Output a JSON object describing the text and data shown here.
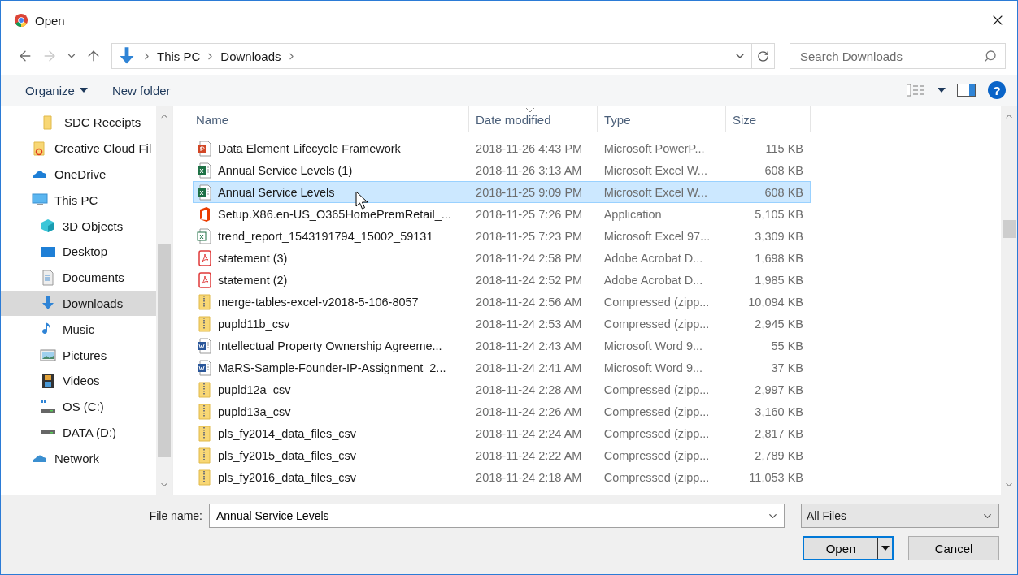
{
  "window": {
    "title": "Open"
  },
  "address": {
    "crumbs": [
      "This PC",
      "Downloads"
    ]
  },
  "search": {
    "placeholder": "Search Downloads"
  },
  "toolbar": {
    "organize": "Organize",
    "new_folder": "New folder",
    "help": "?"
  },
  "sidebar": {
    "items": [
      {
        "label": "SDC Receipts",
        "kind": "folder",
        "selected": false
      },
      {
        "label": "Creative Cloud Fil",
        "kind": "cloudfolder",
        "selected": false
      },
      {
        "label": "OneDrive",
        "kind": "onedrive",
        "selected": false
      },
      {
        "label": "This PC",
        "kind": "pc",
        "selected": false,
        "children": [
          {
            "label": "3D Objects",
            "kind": "cube",
            "selected": false
          },
          {
            "label": "Desktop",
            "kind": "desktop",
            "selected": false
          },
          {
            "label": "Documents",
            "kind": "documents",
            "selected": false
          },
          {
            "label": "Downloads",
            "kind": "downloads",
            "selected": true
          },
          {
            "label": "Music",
            "kind": "music",
            "selected": false
          },
          {
            "label": "Pictures",
            "kind": "pictures",
            "selected": false
          },
          {
            "label": "Videos",
            "kind": "videos",
            "selected": false
          },
          {
            "label": "OS (C:)",
            "kind": "osdrive",
            "selected": false
          },
          {
            "label": "DATA (D:)",
            "kind": "drive",
            "selected": false
          }
        ]
      },
      {
        "label": "Network",
        "kind": "network",
        "selected": false
      }
    ]
  },
  "table": {
    "columns": [
      "Name",
      "Date modified",
      "Type",
      "Size"
    ],
    "rows": [
      {
        "name": "Data Element Lifecycle Framework",
        "date": "2018-11-26 4:43 PM",
        "type": "Microsoft PowerP...",
        "size": "115 KB",
        "kind": "ppt",
        "selected": false
      },
      {
        "name": "Annual Service Levels (1)",
        "date": "2018-11-26 3:13 AM",
        "type": "Microsoft Excel W...",
        "size": "608 KB",
        "kind": "excel",
        "selected": false
      },
      {
        "name": "Annual Service Levels",
        "date": "2018-11-25 9:09 PM",
        "type": "Microsoft Excel W...",
        "size": "608 KB",
        "kind": "excel",
        "selected": true
      },
      {
        "name": "Setup.X86.en-US_O365HomePremRetail_...",
        "date": "2018-11-25 7:26 PM",
        "type": "Application",
        "size": "5,105 KB",
        "kind": "app",
        "selected": false
      },
      {
        "name": "trend_report_1543191794_15002_59131",
        "date": "2018-11-25 7:23 PM",
        "type": "Microsoft Excel 97...",
        "size": "3,309 KB",
        "kind": "csv",
        "selected": false
      },
      {
        "name": "statement (3)",
        "date": "2018-11-24 2:58 PM",
        "type": "Adobe Acrobat D...",
        "size": "1,698 KB",
        "kind": "pdf",
        "selected": false
      },
      {
        "name": "statement (2)",
        "date": "2018-11-24 2:52 PM",
        "type": "Adobe Acrobat D...",
        "size": "1,985 KB",
        "kind": "pdf",
        "selected": false
      },
      {
        "name": "merge-tables-excel-v2018-5-106-8057",
        "date": "2018-11-24 2:56 AM",
        "type": "Compressed (zipp...",
        "size": "10,094 KB",
        "kind": "zip",
        "selected": false
      },
      {
        "name": "pupld11b_csv",
        "date": "2018-11-24 2:53 AM",
        "type": "Compressed (zipp...",
        "size": "2,945 KB",
        "kind": "zip",
        "selected": false
      },
      {
        "name": "Intellectual Property Ownership Agreeme...",
        "date": "2018-11-24 2:43 AM",
        "type": "Microsoft Word 9...",
        "size": "55 KB",
        "kind": "word",
        "selected": false
      },
      {
        "name": "MaRS-Sample-Founder-IP-Assignment_2...",
        "date": "2018-11-24 2:41 AM",
        "type": "Microsoft Word 9...",
        "size": "37 KB",
        "kind": "word",
        "selected": false
      },
      {
        "name": "pupld12a_csv",
        "date": "2018-11-24 2:28 AM",
        "type": "Compressed (zipp...",
        "size": "2,997 KB",
        "kind": "zip",
        "selected": false
      },
      {
        "name": "pupld13a_csv",
        "date": "2018-11-24 2:26 AM",
        "type": "Compressed (zipp...",
        "size": "3,160 KB",
        "kind": "zip",
        "selected": false
      },
      {
        "name": "pls_fy2014_data_files_csv",
        "date": "2018-11-24 2:24 AM",
        "type": "Compressed (zipp...",
        "size": "2,817 KB",
        "kind": "zip",
        "selected": false
      },
      {
        "name": "pls_fy2015_data_files_csv",
        "date": "2018-11-24 2:22 AM",
        "type": "Compressed (zipp...",
        "size": "2,789 KB",
        "kind": "zip",
        "selected": false
      },
      {
        "name": "pls_fy2016_data_files_csv",
        "date": "2018-11-24 2:18 AM",
        "type": "Compressed (zipp...",
        "size": "11,053 KB",
        "kind": "zip",
        "selected": false
      }
    ]
  },
  "footer": {
    "file_name_label": "File name:",
    "file_name_value": "Annual Service Levels",
    "filter": "All Files",
    "open": "Open",
    "cancel": "Cancel"
  }
}
